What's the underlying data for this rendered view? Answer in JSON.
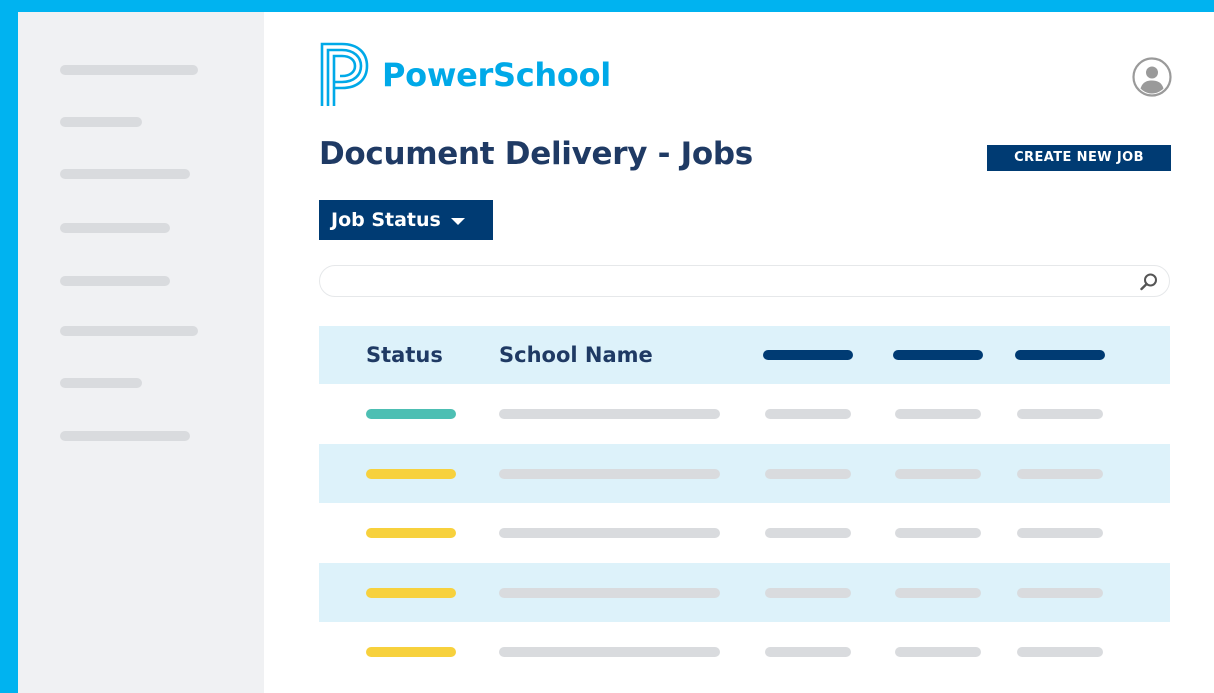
{
  "brand": {
    "name": "PowerSchool",
    "color": "#00a9e8"
  },
  "page": {
    "title": "Document Delivery - Jobs"
  },
  "toolbar": {
    "create_label": "CREATE NEW JOB"
  },
  "filter": {
    "label": "Job Status"
  },
  "search": {
    "value": "",
    "placeholder": ""
  },
  "table": {
    "columns": [
      "Status",
      "School Name"
    ],
    "rows": [
      {
        "status": "complete",
        "status_color": "#4dbfb3"
      },
      {
        "status": "pending",
        "status_color": "#f7d13d"
      },
      {
        "status": "pending",
        "status_color": "#f7d13d"
      },
      {
        "status": "pending",
        "status_color": "#f7d13d"
      },
      {
        "status": "pending",
        "status_color": "#f7d13d"
      }
    ]
  },
  "colors": {
    "frame": "#00b3f0",
    "primary": "#003b73",
    "title": "#1f3a64",
    "row_alt": "#ddf2fa",
    "placeholder": "#d9dbde",
    "sidebar_bg": "#f0f1f3"
  },
  "icons": {
    "logo": "powerschool-p-icon",
    "avatar": "user-avatar-icon",
    "search": "search-icon",
    "dropdown": "caret-down-icon"
  }
}
